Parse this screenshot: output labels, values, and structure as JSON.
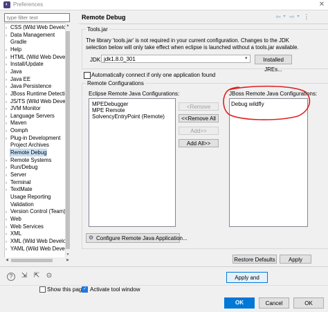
{
  "window": {
    "title": "Preferences",
    "close_glyph": "✕",
    "app_icon_glyph": "◐"
  },
  "filter": {
    "placeholder": "type filter text"
  },
  "tree": {
    "items": [
      {
        "label": "CSS (Wild Web Develope",
        "arrow": "›"
      },
      {
        "label": "Data Management",
        "arrow": "›"
      },
      {
        "label": "Gradle",
        "arrow": ""
      },
      {
        "label": "Help",
        "arrow": "›"
      },
      {
        "label": "HTML (Wild Web Develo",
        "arrow": "›"
      },
      {
        "label": "Install/Update",
        "arrow": "›"
      },
      {
        "label": "Java",
        "arrow": "›"
      },
      {
        "label": "Java EE",
        "arrow": "›"
      },
      {
        "label": "Java Persistence",
        "arrow": "›"
      },
      {
        "label": "JBoss Runtime Detection",
        "arrow": "›"
      },
      {
        "label": "JS/TS (Wild Web Develo",
        "arrow": "›"
      },
      {
        "label": "JVM Monitor",
        "arrow": "›"
      },
      {
        "label": "Language Servers",
        "arrow": "›"
      },
      {
        "label": "Maven",
        "arrow": "›"
      },
      {
        "label": "Oomph",
        "arrow": "›"
      },
      {
        "label": "Plug-in Development",
        "arrow": "›"
      },
      {
        "label": "Project Archives",
        "arrow": ""
      },
      {
        "label": "Remote Debug",
        "arrow": "",
        "selected": true
      },
      {
        "label": "Remote Systems",
        "arrow": "›"
      },
      {
        "label": "Run/Debug",
        "arrow": "›"
      },
      {
        "label": "Server",
        "arrow": "›"
      },
      {
        "label": "Terminal",
        "arrow": "›"
      },
      {
        "label": "TextMate",
        "arrow": "›"
      },
      {
        "label": "Usage Reporting",
        "arrow": ""
      },
      {
        "label": "Validation",
        "arrow": ""
      },
      {
        "label": "Version Control (Team)",
        "arrow": "›"
      },
      {
        "label": "Web",
        "arrow": "›"
      },
      {
        "label": "Web Services",
        "arrow": "›"
      },
      {
        "label": "XML",
        "arrow": "›"
      },
      {
        "label": "XML (Wild Web Develop",
        "arrow": "›"
      },
      {
        "label": "YAML (Wild Web Develo",
        "arrow": "›"
      }
    ]
  },
  "header": {
    "title": "Remote Debug",
    "back_glyph": "⇦",
    "back_menu_glyph": "▾",
    "forward_glyph": "⇨",
    "forward_menu_glyph": "▾",
    "more_glyph": "⋮"
  },
  "toolsjar": {
    "group_label": "Tools.jar",
    "info_line1": "The library 'tools.jar' is not required in your current configuration.  Changes to the JDK",
    "info_line2": "selection below will only take effect when eclipse is launched without a tools.jar available.",
    "jdk_label": "JDK:",
    "jdk_value": "jdk1.8.0_301",
    "jdk_caret": "▾",
    "installed_jres_label": "Installed JREs..."
  },
  "auto_connect": {
    "label": "Automatically connect if only one application found",
    "checked": false
  },
  "remote": {
    "group_label": "Remote Configurations",
    "eclipse_label": "Eclipse Remote Java Configurations:",
    "eclipse_items": [
      "MPEDebugger",
      "MPE Remote",
      "SolvencyEntryPoint (Remote)"
    ],
    "jboss_label": "JBoss Remote Java Configurations:",
    "jboss_items": [
      "Debug wildfly"
    ],
    "remove_label": "<Remove",
    "remove_all_label": "<<Remove All",
    "add_label": "Add>>",
    "add_all_label": "Add All>>",
    "configure_label": "Configure Remote Java Application...",
    "configure_icon_glyph": "⚙"
  },
  "actions": {
    "restore_defaults": "Restore Defaults",
    "apply": "Apply",
    "apply_and_close": "Apply and Close",
    "help_glyph": "?",
    "import_glyph": "⇲",
    "export_glyph": "⇱",
    "link_glyph": "⊙"
  },
  "footer": {
    "show_this_page": "Show this page",
    "activate_tool_window": "Activate tool window",
    "tool_check_glyph": "✓",
    "ok": "OK",
    "cancel": "Cancel",
    "ok_secondary": "OK"
  },
  "scroll_glyphs": {
    "up": "▲",
    "down": "▼",
    "left": "◀",
    "right": "▶"
  },
  "colors": {
    "annotation_red": "#e02020",
    "selection": "#cce4f7",
    "primary_button": "#0078d7"
  }
}
